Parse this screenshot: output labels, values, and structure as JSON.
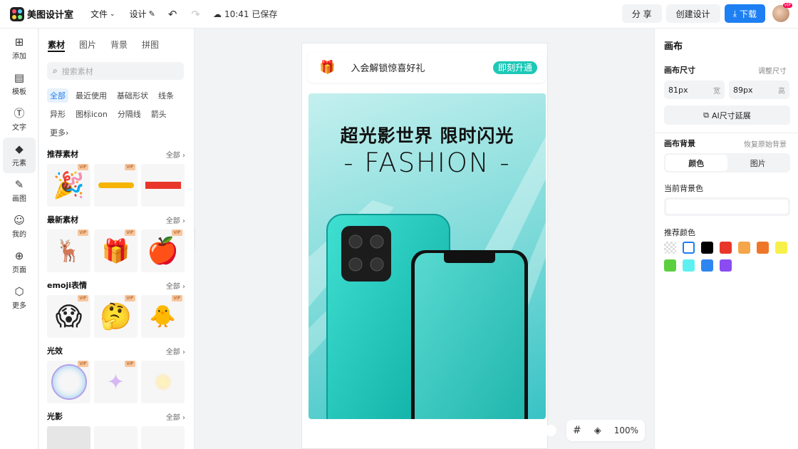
{
  "app": {
    "name": "美图设计室",
    "menu": {
      "file": "文件",
      "design": "设计"
    },
    "save_status": "10:41 已保存",
    "actions": {
      "share": "分 享",
      "create": "创建设计",
      "download": "下载"
    },
    "avatar_badge": "VIP"
  },
  "leftnav": [
    {
      "label": "添加",
      "icon": "plus-square-icon"
    },
    {
      "label": "模板",
      "icon": "template-icon"
    },
    {
      "label": "文字",
      "icon": "text-icon"
    },
    {
      "label": "元素",
      "icon": "element-icon",
      "active": true
    },
    {
      "label": "画图",
      "icon": "pencil-icon"
    },
    {
      "label": "我的",
      "icon": "user-icon"
    },
    {
      "label": "页面",
      "icon": "page-icon"
    },
    {
      "label": "更多",
      "icon": "cube-icon"
    }
  ],
  "material": {
    "tabs": [
      "素材",
      "图片",
      "背景",
      "拼图"
    ],
    "active_tab": "素材",
    "search_placeholder": "搜索素材",
    "chips": [
      "全部",
      "最近使用",
      "基础形状",
      "线条",
      "异形",
      "图标icon",
      "分隔线",
      "箭头",
      "更多"
    ],
    "all_label": "全部",
    "vip_label": "VIP",
    "sections": [
      {
        "title": "推荐素材"
      },
      {
        "title": "最新素材"
      },
      {
        "title": "emoji表情"
      },
      {
        "title": "光效"
      },
      {
        "title": "光影"
      }
    ]
  },
  "canvas": {
    "promo_text": "入会解锁惊喜好礼",
    "promo_button": "即刻升通",
    "poster_title": "超光影世界 限时闪光",
    "poster_subtitle": "- FASHION -",
    "zoom": "100%"
  },
  "right": {
    "title": "画布",
    "size_label": "画布尺寸",
    "adjust_size": "调整尺寸",
    "width": {
      "value": "81px",
      "unit": "宽"
    },
    "height": {
      "value": "89px",
      "unit": "高"
    },
    "ai_extend": "AI尺寸延展",
    "bg_label": "画布背景",
    "restore_bg": "恢复原始背景",
    "bg_tabs": [
      "颜色",
      "图片"
    ],
    "current_bg_label": "当前背景色",
    "recommend_label": "推荐颜色",
    "swatches": [
      "transparent",
      "#ffffff",
      "#000000",
      "#e8372a",
      "#f5a54a",
      "#ef7628",
      "#f8f04a",
      "#5ccf3f",
      "#5ef0f0",
      "#2f86f0",
      "#8a4cf0"
    ]
  }
}
